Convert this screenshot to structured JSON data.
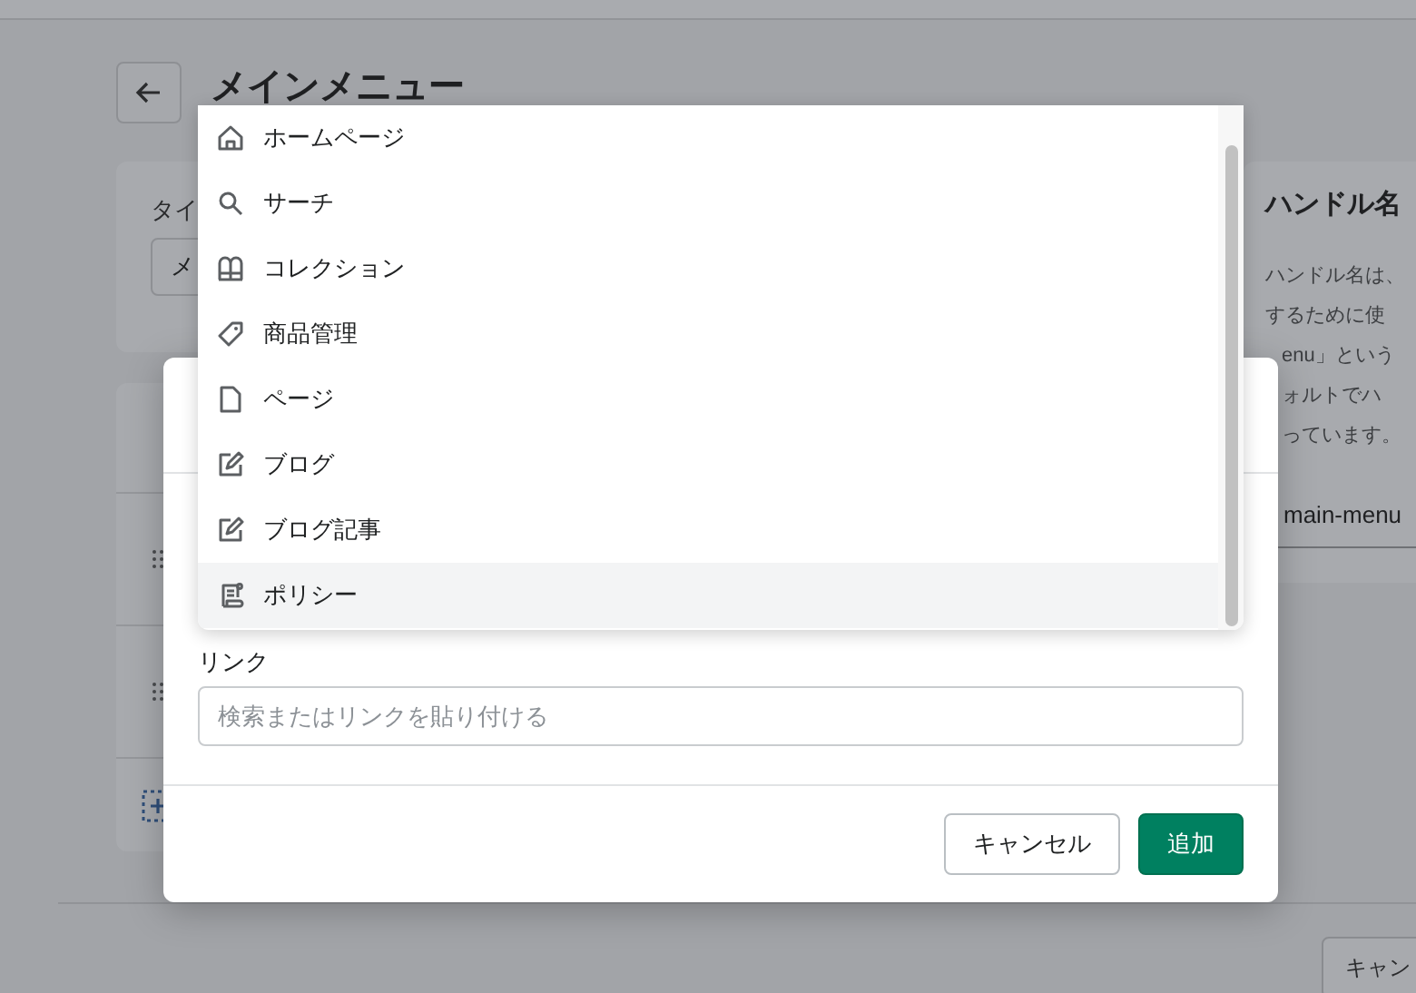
{
  "page": {
    "title": "メインメニュー"
  },
  "title_card": {
    "label": "タイ",
    "value": "メ"
  },
  "handle_card": {
    "title": "ハンドル名",
    "lines": [
      {
        "text": "ハンドル名は、"
      },
      {
        "text": "するために使"
      },
      {
        "text": "enu」という"
      },
      {
        "text": "ォルトでハ"
      },
      {
        "text": "っています。"
      }
    ],
    "value": "main-menu"
  },
  "footer": {
    "button": "キャン"
  },
  "modal": {
    "link_field": {
      "label": "リンク",
      "placeholder": "検索またはリンクを貼り付ける"
    },
    "buttons": [
      {
        "label": "キャンセル",
        "kind": "secondary"
      },
      {
        "label": "追加",
        "kind": "primary"
      }
    ]
  },
  "dropdown": {
    "items": [
      {
        "label": "ホームページ",
        "kind": "home",
        "selected": false
      },
      {
        "label": "サーチ",
        "kind": "search",
        "selected": false
      },
      {
        "label": "コレクション",
        "kind": "collection",
        "selected": false
      },
      {
        "label": "商品管理",
        "kind": "tag",
        "selected": false
      },
      {
        "label": "ページ",
        "kind": "page",
        "selected": false
      },
      {
        "label": "ブログ",
        "kind": "blog",
        "selected": false
      },
      {
        "label": "ブログ記事",
        "kind": "blog",
        "selected": false
      },
      {
        "label": "ポリシー",
        "kind": "policy",
        "selected": true
      }
    ]
  }
}
